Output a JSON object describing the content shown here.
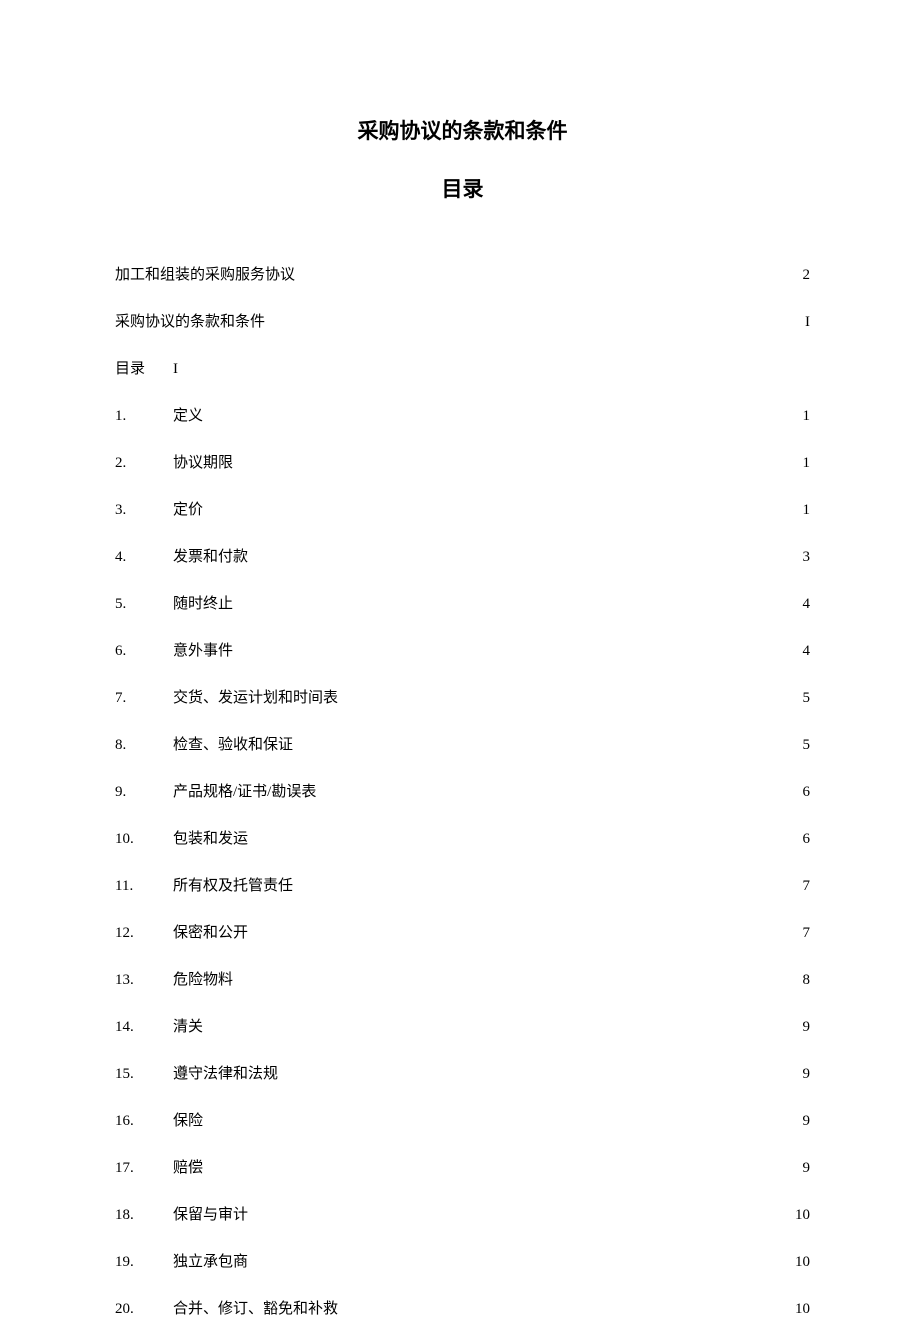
{
  "title": "采购协议的条款和条件",
  "subtitle": "目录",
  "pre": [
    {
      "label": "加工和组装的采购服务协议",
      "page": "2"
    },
    {
      "label": "采购协议的条款和条件",
      "page": "I"
    }
  ],
  "mulu": {
    "label": "目录",
    "page": "I"
  },
  "items": [
    {
      "num": "1.",
      "label": "定义",
      "page": "1"
    },
    {
      "num": "2.",
      "label": "协议期限",
      "page": "1"
    },
    {
      "num": "3.",
      "label": "定价",
      "page": "1"
    },
    {
      "num": "4.",
      "label": "发票和付款",
      "page": "3"
    },
    {
      "num": "5.",
      "label": "随时终止",
      "page": "4"
    },
    {
      "num": "6.",
      "label": "意外事件",
      "page": "4"
    },
    {
      "num": "7.",
      "label": "交货、发运计划和时间表",
      "page": "5"
    },
    {
      "num": "8.",
      "label": "检查、验收和保证",
      "page": "5"
    },
    {
      "num": "9.",
      "label": "产品规格/证书/勘误表",
      "page": "6"
    },
    {
      "num": "10.",
      "label": "包装和发运",
      "page": "6"
    },
    {
      "num": "11.",
      "label": "所有权及托管责任",
      "page": "7"
    },
    {
      "num": "12.",
      "label": "保密和公开",
      "page": "7"
    },
    {
      "num": "13.",
      "label": "危险物料",
      "page": "8"
    },
    {
      "num": "14.",
      "label": "清关",
      "page": "9"
    },
    {
      "num": "15.",
      "label": "遵守法律和法规",
      "page": "9"
    },
    {
      "num": "16.",
      "label": "保险",
      "page": "9"
    },
    {
      "num": "17.",
      "label": "赔偿",
      "page": "9"
    },
    {
      "num": "18.",
      "label": "保留与审计",
      "page": "10"
    },
    {
      "num": "19.",
      "label": "独立承包商",
      "page": "10"
    },
    {
      "num": "20.",
      "label": "合并、修订、豁免和补救",
      "page": "10"
    }
  ]
}
